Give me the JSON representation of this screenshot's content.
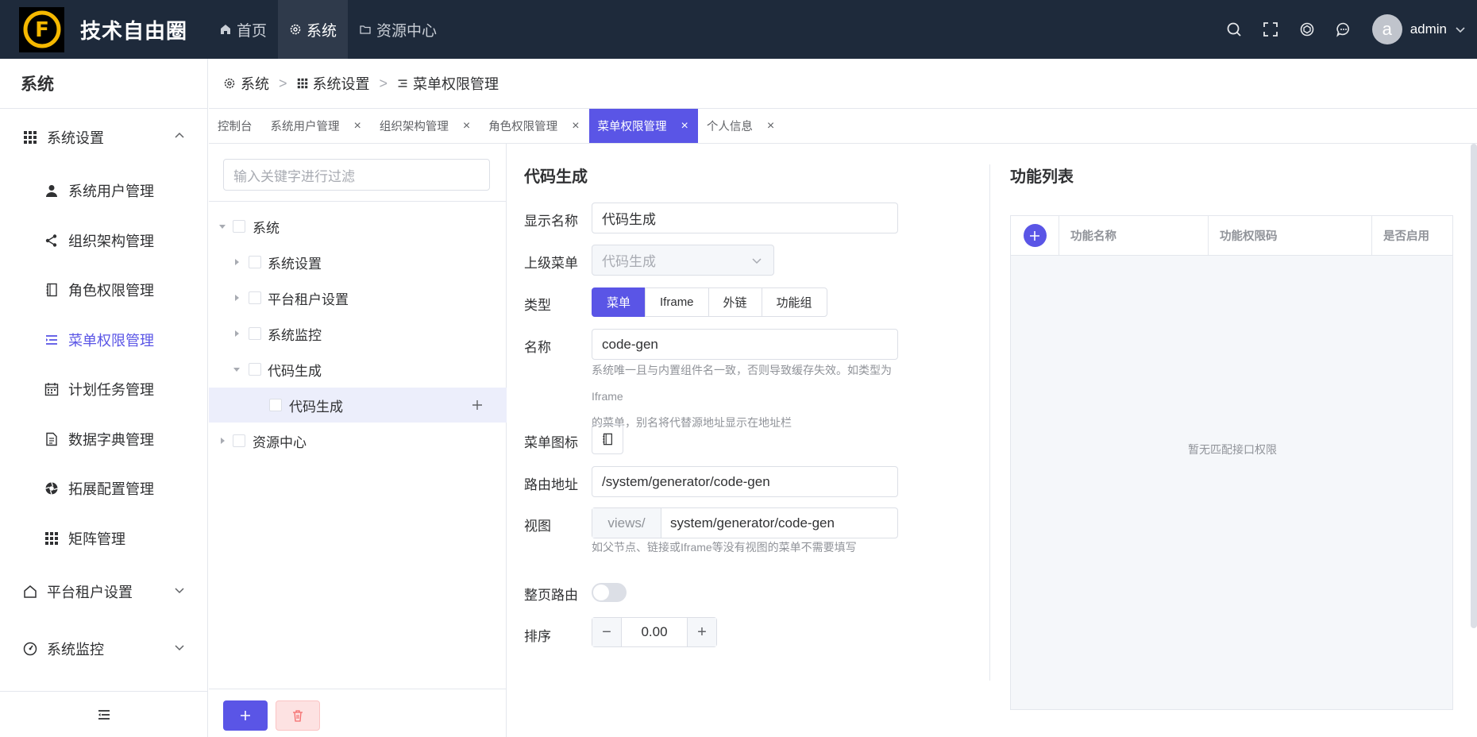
{
  "app": {
    "brand": "技术自由圈",
    "logo_letter": "F"
  },
  "topnav": [
    {
      "label": "首页",
      "icon": "home-icon"
    },
    {
      "label": "系统",
      "icon": "gear-icon",
      "active": true
    },
    {
      "label": "资源中心",
      "icon": "folder-icon"
    }
  ],
  "user": {
    "avatar_letter": "a",
    "name": "admin"
  },
  "sidebar": {
    "title": "系统",
    "group_system_settings": "系统设置",
    "items": [
      {
        "label": "系统用户管理",
        "icon": "user-icon"
      },
      {
        "label": "组织架构管理",
        "icon": "share-icon"
      },
      {
        "label": "角色权限管理",
        "icon": "notebook-icon"
      },
      {
        "label": "菜单权限管理",
        "icon": "menu-list-icon",
        "active": true
      },
      {
        "label": "计划任务管理",
        "icon": "calendar-icon"
      },
      {
        "label": "数据字典管理",
        "icon": "document-icon"
      },
      {
        "label": "拓展配置管理",
        "icon": "aperture-icon"
      },
      {
        "label": "矩阵管理",
        "icon": "grid-icon"
      }
    ],
    "group_tenant": "平台租户设置",
    "group_monitor": "系统监控"
  },
  "breadcrumb": [
    "系统",
    "系统设置",
    "菜单权限管理"
  ],
  "tabs": [
    {
      "label": "控制台",
      "closable": false
    },
    {
      "label": "系统用户管理",
      "closable": true
    },
    {
      "label": "组织架构管理",
      "closable": true
    },
    {
      "label": "角色权限管理",
      "closable": true
    },
    {
      "label": "菜单权限管理",
      "closable": true,
      "active": true
    },
    {
      "label": "个人信息",
      "closable": true
    }
  ],
  "tree": {
    "filter_placeholder": "输入关键字进行过滤",
    "nodes": [
      "系统",
      "系统设置",
      "平台租户设置",
      "系统监控",
      "代码生成",
      "代码生成",
      "资源中心"
    ]
  },
  "form": {
    "title": "代码生成",
    "display_name_label": "显示名称",
    "display_name_value": "代码生成",
    "parent_label": "上级菜单",
    "parent_value": "代码生成",
    "type_label": "类型",
    "type_options": [
      "菜单",
      "Iframe",
      "外链",
      "功能组"
    ],
    "type_selected": "菜单",
    "name_label": "名称",
    "name_value": "code-gen",
    "name_hint_1": "系统唯一且与内置组件名一致，否则导致缓存失效。如类型为Iframe",
    "name_hint_2": "的菜单，别名将代替源地址显示在地址栏",
    "icon_label": "菜单图标",
    "route_label": "路由地址",
    "route_value": "/system/generator/code-gen",
    "view_label": "视图",
    "view_prefix": "views/",
    "view_value": "system/generator/code-gen",
    "view_hint": "如父节点、链接或Iframe等没有视图的菜单不需要填写",
    "fullpage_label": "整页路由",
    "fullpage_on": false,
    "sort_label": "排序",
    "sort_value": "0.00"
  },
  "functions": {
    "title": "功能列表",
    "columns": [
      "功能名称",
      "功能权限码",
      "是否启用"
    ],
    "empty_text": "暂无匹配接口权限"
  },
  "colors": {
    "primary": "#5a55e6",
    "topbar": "#1e2a3b",
    "danger": "#f56c6c"
  }
}
